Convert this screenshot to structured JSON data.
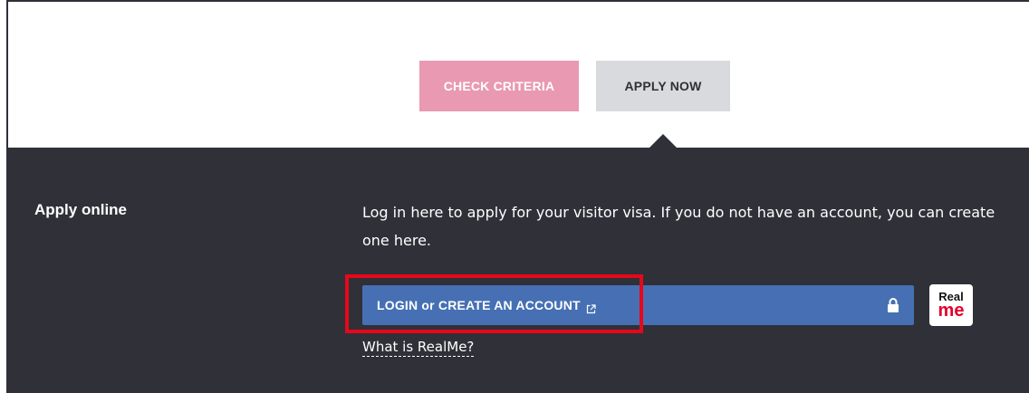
{
  "buttons": {
    "check_criteria": "CHECK CRITERIA",
    "apply_now": "APPLY NOW"
  },
  "apply": {
    "title": "Apply online",
    "intro": "Log in here to apply for your visitor visa. If you do not have an account, you can create one here.",
    "login_label": "LOGIN or CREATE AN ACCOUNT",
    "what_link": "What is RealMe?"
  },
  "logo": {
    "line1": "Real",
    "line2": "me"
  },
  "icons": {
    "external": "external-link-icon",
    "lock": "lock-icon"
  },
  "colors": {
    "check_button": "#e999b1",
    "apply_button": "#d9dadd",
    "panel": "#2f3038",
    "login_button": "#4670b3",
    "highlight": "#e8071a"
  }
}
